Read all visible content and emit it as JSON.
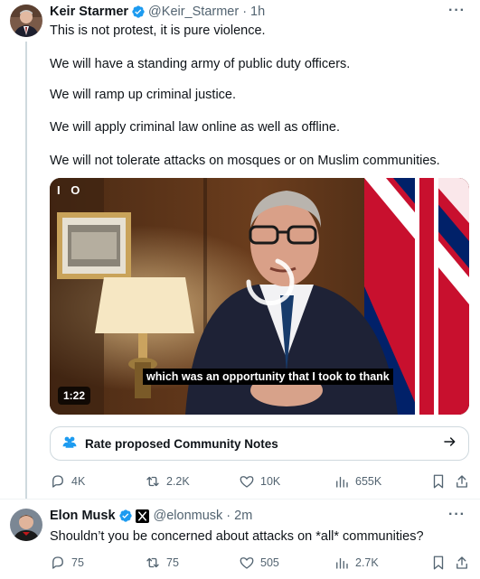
{
  "tweets": [
    {
      "author": {
        "name": "Keir Starmer",
        "handle": "@Keir_Starmer",
        "separator": "·",
        "time": "1h"
      },
      "lines": [
        "This is not protest, it is pure violence.",
        "We will have a standing army of public duty officers.",
        "We will ramp up criminal justice.",
        "We will apply criminal law online as well as offline.",
        "We will not tolerate attacks on mosques or on Muslim communities."
      ],
      "video": {
        "indicator": "I O",
        "caption": "which was an opportunity that I took to thank",
        "duration": "1:22"
      },
      "community_notes": {
        "label": "Rate proposed Community Notes"
      },
      "stats": {
        "replies": "4K",
        "reposts": "2.2K",
        "likes": "10K",
        "views": "655K"
      }
    },
    {
      "author": {
        "name": "Elon Musk",
        "handle": "@elonmusk",
        "separator": "·",
        "time": "2m"
      },
      "lines": [
        "Shouldn’t you be concerned about attacks on *all* communities?"
      ],
      "stats": {
        "replies": "75",
        "reposts": "75",
        "likes": "505",
        "views": "2.7K"
      }
    }
  ],
  "icons": [
    "verified-badge-icon",
    "more-icon",
    "people-icon",
    "arrow-right-icon",
    "reply-icon",
    "repost-icon",
    "like-icon",
    "views-icon",
    "bookmark-icon",
    "share-icon",
    "x-logo-icon"
  ],
  "colors": {
    "verified": "#1d9bf0",
    "notes_icon": "#1d9bf0",
    "muted": "#536471",
    "border": "#cfd9de"
  }
}
